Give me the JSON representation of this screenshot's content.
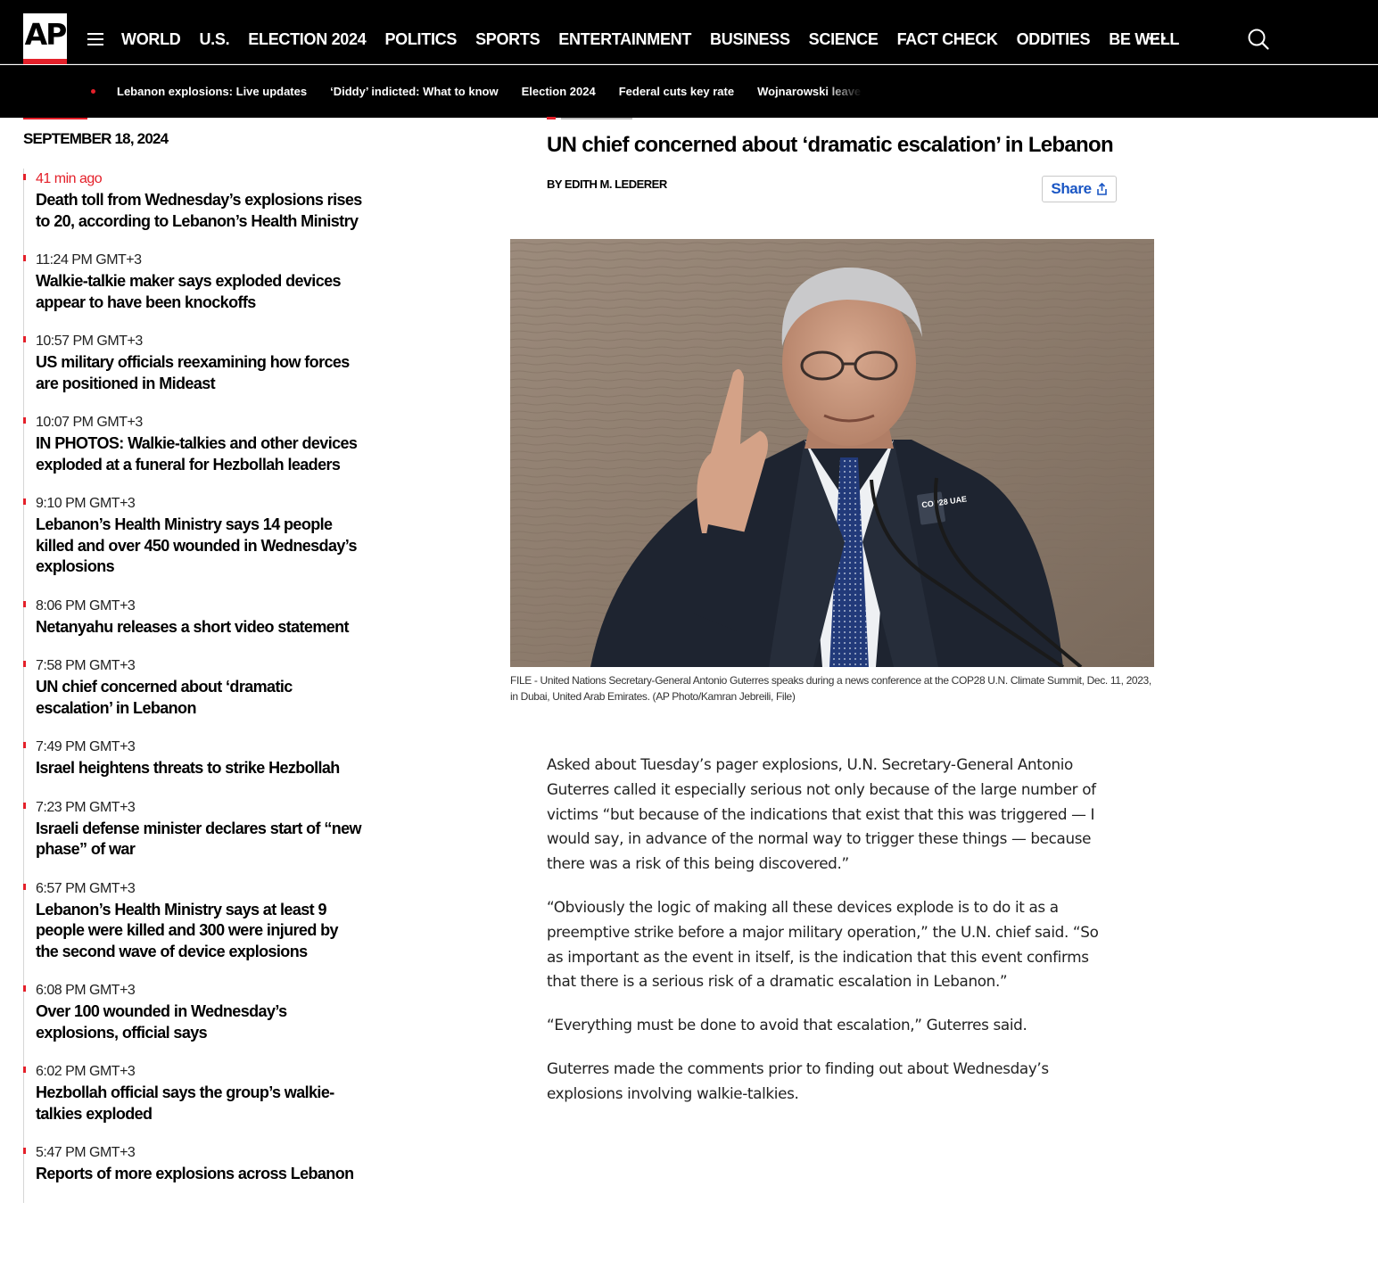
{
  "nav": {
    "logo": "AP",
    "items": [
      "WORLD",
      "U.S.",
      "ELECTION 2024",
      "POLITICS",
      "SPORTS",
      "ENTERTAINMENT",
      "BUSINESS",
      "SCIENCE",
      "FACT CHECK",
      "ODDITIES",
      "BE WELL"
    ],
    "more": "···"
  },
  "trending": {
    "items": [
      "Lebanon explosions: Live updates",
      "‘Diddy’ indicted: What to know",
      "Election 2024",
      "Federal cuts key rate",
      "Wojnarowski leaves ESPN"
    ]
  },
  "timeline": {
    "date": "SEPTEMBER 18, 2024",
    "items": [
      {
        "time": "41 min ago",
        "headline": "Death toll from Wednesday’s explosions rises to 20, according to Lebanon’s Health Ministry",
        "recent": true
      },
      {
        "time": "11:24 PM GMT+3",
        "headline": "Walkie-talkie maker says exploded devices appear to have been knockoffs"
      },
      {
        "time": "10:57 PM GMT+3",
        "headline": "US military officials reexamining how forces are positioned in Mideast"
      },
      {
        "time": "10:07 PM GMT+3",
        "headline": "IN PHOTOS: Walkie-talkies and other devices exploded at a funeral for Hezbollah leaders"
      },
      {
        "time": "9:10 PM GMT+3",
        "headline": "Lebanon’s Health Ministry says 14 people killed and over 450 wounded in Wednesday’s explosions"
      },
      {
        "time": "8:06 PM GMT+3",
        "headline": "Netanyahu releases a short video statement"
      },
      {
        "time": "7:58 PM GMT+3",
        "headline": "UN chief concerned about ‘dramatic escalation’ in Lebanon"
      },
      {
        "time": "7:49 PM GMT+3",
        "headline": "Israel heightens threats to strike Hezbollah"
      },
      {
        "time": "7:23 PM GMT+3",
        "headline": "Israeli defense minister declares start of “new phase” of war"
      },
      {
        "time": "6:57 PM GMT+3",
        "headline": "Lebanon’s Health Ministry says at least 9 people were killed and 300 were injured by the second wave of device explosions"
      },
      {
        "time": "6:08 PM GMT+3",
        "headline": "Over 100 wounded in Wednesday’s explosions, official says"
      },
      {
        "time": "6:02 PM GMT+3",
        "headline": "Hezbollah official says the group’s walkie-talkies exploded"
      },
      {
        "time": "5:47 PM GMT+3",
        "headline": "Reports of more explosions across Lebanon"
      }
    ]
  },
  "article": {
    "title": "UN chief concerned about ‘dramatic escalation’ in Lebanon",
    "byline": "BY EDITH M. LEDERER",
    "share_label": "Share",
    "photo_badge": "COP28 UAE",
    "caption": "FILE - United Nations Secretary-General Antonio Guterres speaks during a news conference at the COP28 U.N. Climate Summit, Dec. 11, 2023, in Dubai, United Arab Emirates. (AP Photo/Kamran Jebreili, File)",
    "paragraphs": [
      "Asked about Tuesday’s pager explosions, U.N. Secretary-General Antonio Guterres called it especially serious not only because of the large number of victims “but because of the indications that exist that this was triggered — I would say, in advance of the normal way to trigger these things — because there was a risk of this being discovered.”",
      "“Obviously the logic of making all these devices explode is to do it as a preemptive strike before a major military operation,” the U.N. chief said. “So as important as the event in itself, is the indication that this event confirms that there is a serious risk of a dramatic escalation in Lebanon.”",
      "“Everything must be done to avoid that escalation,” Guterres said.",
      "Guterres made the comments prior to finding out about Wednesday’s explosions involving walkie-talkies."
    ]
  },
  "colors": {
    "nav_bg": "#000000",
    "accent_red": "#e4202a",
    "link_blue": "#1a56c4"
  },
  "icons": {
    "menu": "hamburger-icon",
    "search": "search-icon",
    "share": "share-icon"
  }
}
